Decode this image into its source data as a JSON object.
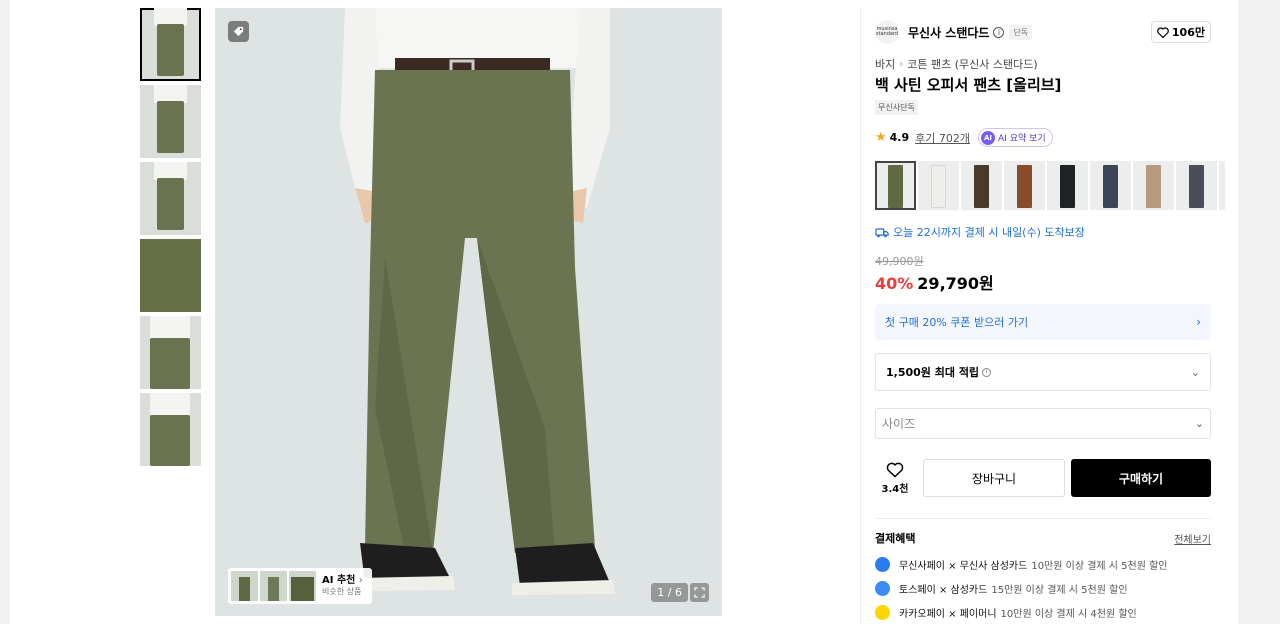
{
  "gallery": {
    "counter": "1 / 6",
    "ai_rec": {
      "title": "AI 추천",
      "subtitle": "비슷한 상품"
    }
  },
  "product": {
    "brand": "무신사 스탠다드",
    "brand_logo_text": "musinsa standard",
    "exclusive_tag": "단독",
    "likes": "106만",
    "breadcrumb": [
      "바지",
      "코튼 팬츠 (무신사 스탠다드)"
    ],
    "title": "백 사틴 오피서 팬츠 [올리브]",
    "badge": "무신사단독",
    "rating": "4.9",
    "reviews": "후기 702개",
    "ai_summary": "AI 요약 보기",
    "ai_icon": "AI",
    "color_swatches": [
      "#5f6a45",
      "#eeeeea",
      "#4a3a2c",
      "#8a4a2e",
      "#1e2126",
      "#3a4558",
      "#b89a7e",
      "#4a4e58",
      "#c9cdcf"
    ],
    "delivery": "오늘 22시까지 결제 시 내일(수) 도착보장",
    "original_price": "49,900원",
    "discount": "40%",
    "price": "29,790원",
    "coupon": "첫 구매 20% 쿠폰 받으러 가기",
    "points": "1,500원 최대 적립",
    "size_placeholder": "사이즈",
    "wish_count": "3.4천",
    "cart": "장바구니",
    "buy": "구매하기"
  },
  "benefits": {
    "header": "결제혜택",
    "view_all": "전체보기",
    "items": [
      {
        "pay": "무신사페이 × 무신사 삼성카드",
        "desc": "10만원 이상 결제 시 5천원 할인",
        "color": "#2b7bf0"
      },
      {
        "pay": "토스페이 × 삼성카드",
        "desc": "15만원 이상 결제 시 5천원 할인",
        "color": "#3b8cf6"
      },
      {
        "pay": "카카오페이 × 페이머니",
        "desc": "10만원 이상 결제 시 4천원 할인",
        "color": "#ffd400"
      }
    ]
  }
}
